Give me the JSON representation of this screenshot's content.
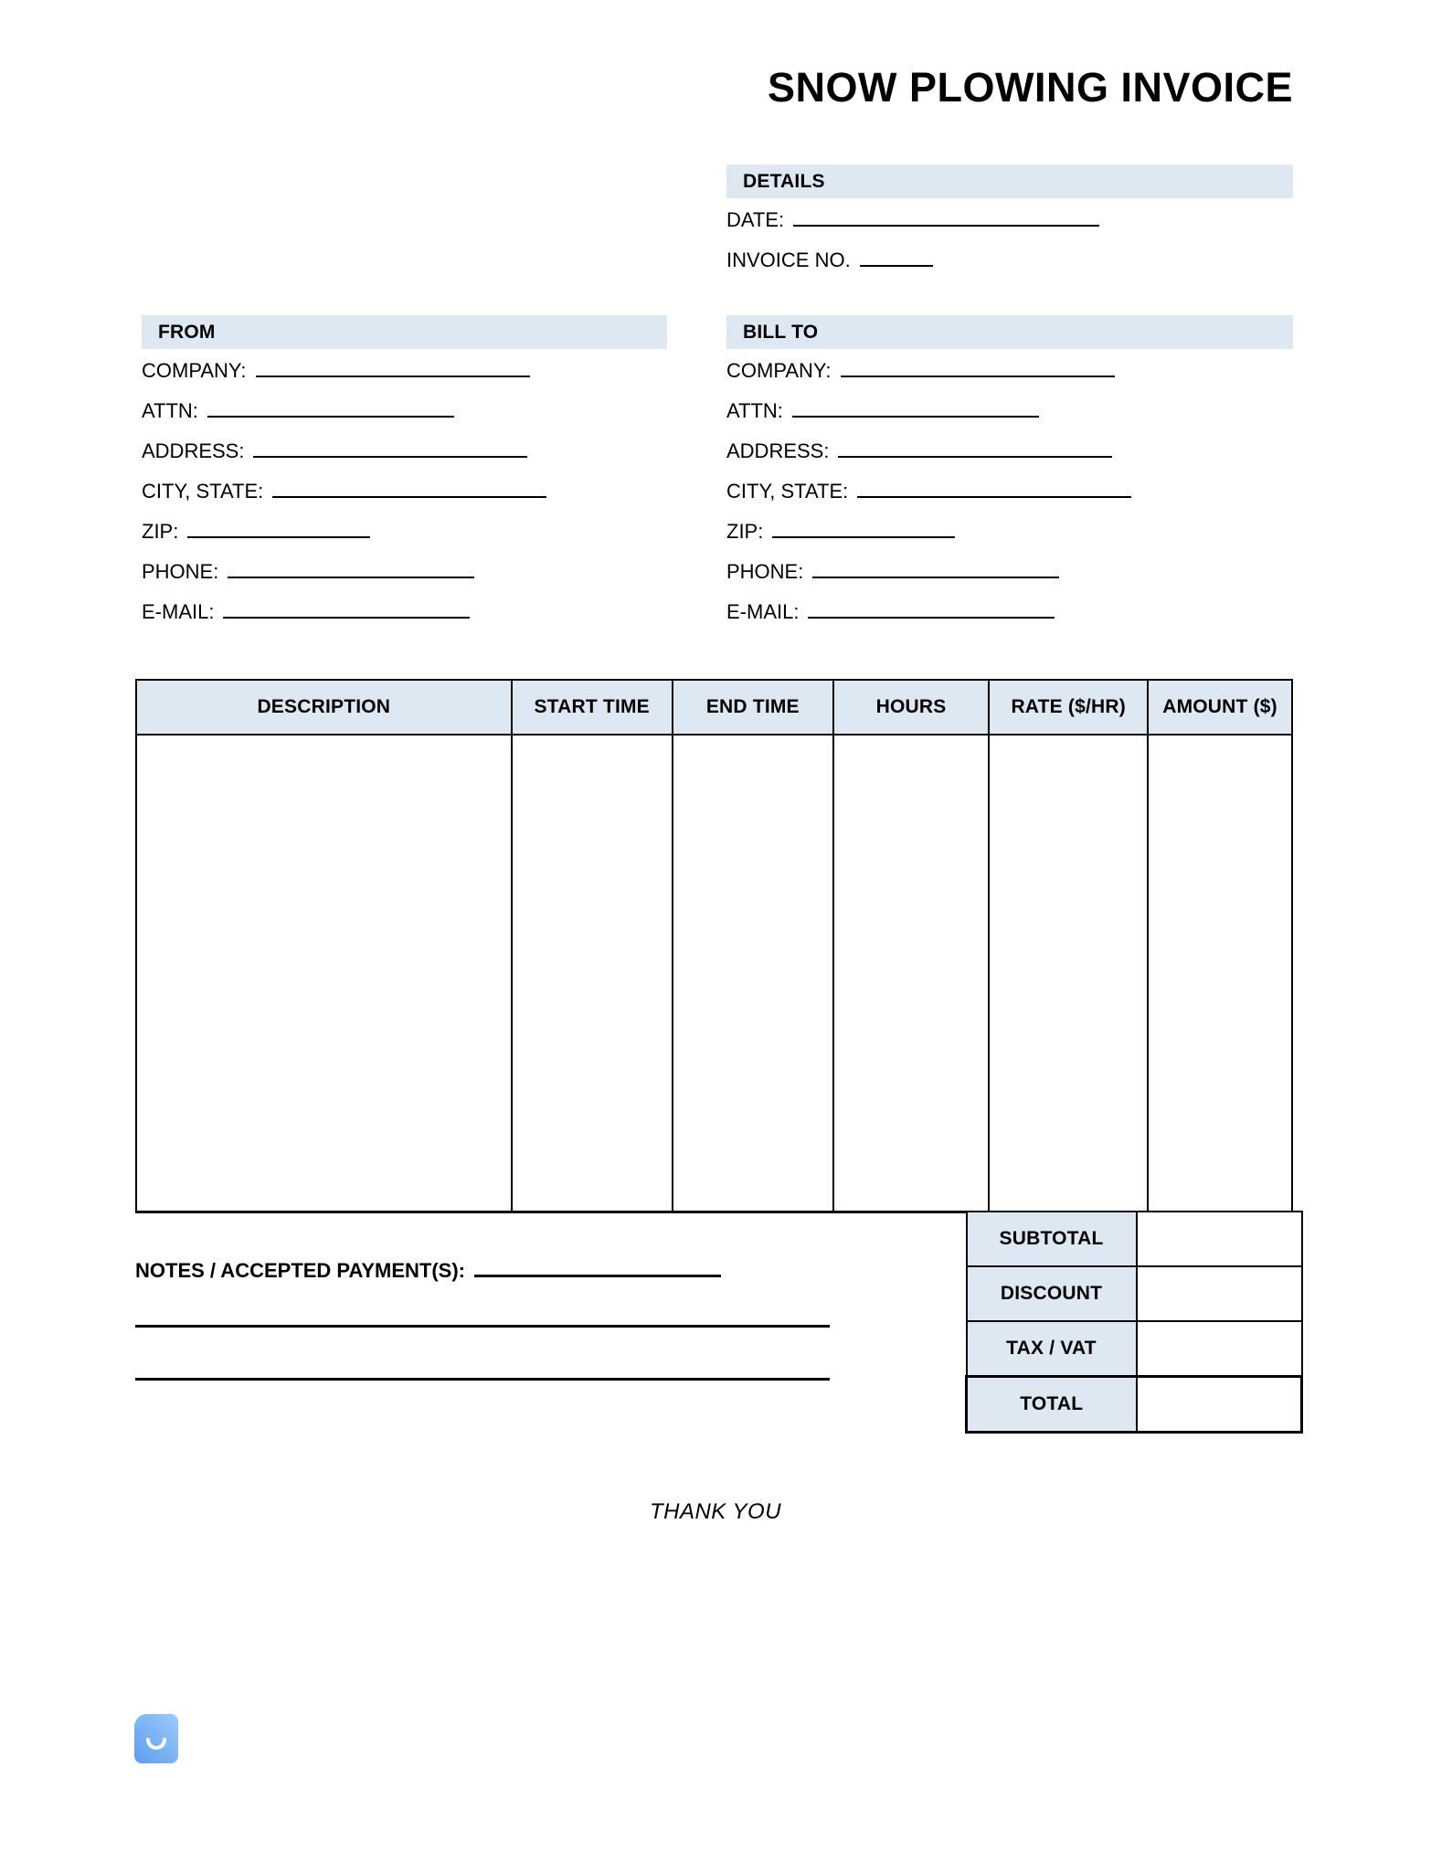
{
  "document": {
    "title": "SNOW PLOWING INVOICE",
    "footer_note": "THANK YOU"
  },
  "colors": {
    "header_band": "#dde8f3",
    "border": "#000000",
    "brand_blue_light": "#8fc2f7",
    "brand_blue_dark": "#5d9cf0"
  },
  "details": {
    "heading": "DETAILS",
    "fields": [
      {
        "label": "DATE:",
        "value": ""
      },
      {
        "label": "INVOICE NO.",
        "value": ""
      }
    ]
  },
  "from": {
    "heading": "FROM",
    "fields": [
      {
        "label": "COMPANY:",
        "value": ""
      },
      {
        "label": "ATTN:",
        "value": ""
      },
      {
        "label": "ADDRESS:",
        "value": ""
      },
      {
        "label": "CITY, STATE:",
        "value": ""
      },
      {
        "label": "ZIP:",
        "value": ""
      },
      {
        "label": "PHONE:",
        "value": ""
      },
      {
        "label": "E-MAIL:",
        "value": ""
      }
    ]
  },
  "bill_to": {
    "heading": "BILL TO",
    "fields": [
      {
        "label": "COMPANY:",
        "value": ""
      },
      {
        "label": "ATTN:",
        "value": ""
      },
      {
        "label": "ADDRESS:",
        "value": ""
      },
      {
        "label": "CITY, STATE:",
        "value": ""
      },
      {
        "label": "ZIP:",
        "value": ""
      },
      {
        "label": "PHONE:",
        "value": ""
      },
      {
        "label": "E-MAIL:",
        "value": ""
      }
    ]
  },
  "line_items": {
    "columns": [
      "DESCRIPTION",
      "START TIME",
      "END TIME",
      "HOURS",
      "RATE ($/HR)",
      "AMOUNT ($)"
    ],
    "rows": []
  },
  "totals": [
    {
      "label": "SUBTOTAL",
      "value": ""
    },
    {
      "label": "DISCOUNT",
      "value": ""
    },
    {
      "label": "TAX / VAT",
      "value": ""
    },
    {
      "label": "TOTAL",
      "value": ""
    }
  ],
  "notes": {
    "label": "NOTES / ACCEPTED PAYMENT(S):",
    "value": "",
    "extra_lines": [
      "",
      ""
    ]
  }
}
